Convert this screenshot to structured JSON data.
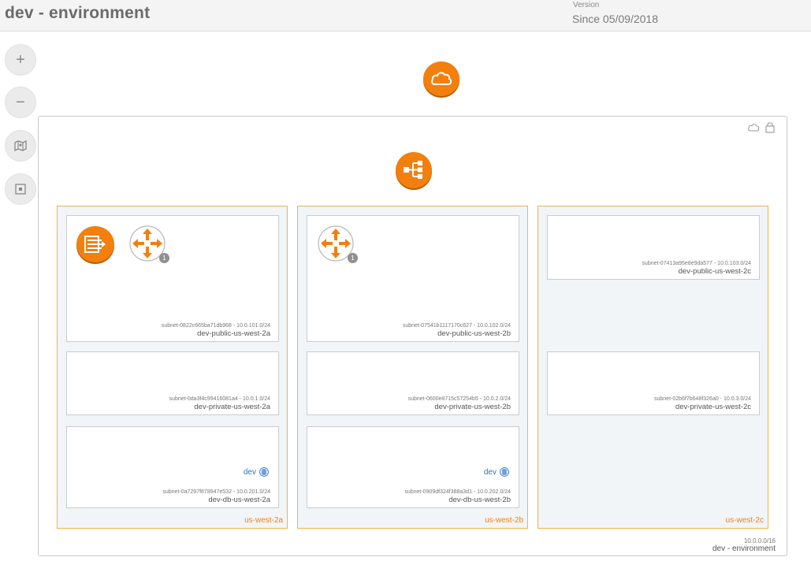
{
  "header": {
    "title": "dev - environment",
    "version_label": "Version",
    "version_value": "Since 05/09/2018"
  },
  "toolbar": {
    "zoom_in": "+",
    "zoom_out": "−"
  },
  "vpc": {
    "cidr": "10.0.0.0/16",
    "name": "dev - environment"
  },
  "zones": [
    {
      "label": "us-west-2a",
      "subnets": [
        {
          "id": "subnet-0822c665ba71db968 - 10.0.101.0/24",
          "name": "dev-public-us-west-2a"
        },
        {
          "id": "subnet-0da3f4c99416081a4 - 10.0.1.0/24",
          "name": "dev-private-us-west-2a"
        },
        {
          "id": "subnet-0a7297f878947e532 - 10.0.201.0/24",
          "name": "dev-db-us-west-2a",
          "db_label": "dev"
        }
      ],
      "router_badge": "1"
    },
    {
      "label": "us-west-2b",
      "subnets": [
        {
          "id": "subnet-07541b1117170c627 - 10.0.102.0/24",
          "name": "dev-public-us-west-2b"
        },
        {
          "id": "subnet-0600e8715c57254b5 - 10.0.2.0/24",
          "name": "dev-private-us-west-2b"
        },
        {
          "id": "subnet-0909df324f388a3d1 - 10.0.202.0/24",
          "name": "dev-db-us-west-2b",
          "db_label": "dev"
        }
      ],
      "router_badge": "1"
    },
    {
      "label": "us-west-2c",
      "subnets": [
        {
          "id": "subnet-07413a95e8e9da577 - 10.0.103.0/24",
          "name": "dev-public-us-west-2c"
        },
        {
          "id": "subnet-02b6f7b648f326a0 - 10.0.3.0/24",
          "name": "dev-private-us-west-2c"
        }
      ]
    }
  ],
  "colors": {
    "accent": "#f37f0f",
    "zone_border": "#f2b24a",
    "db_blue": "#2e74c0"
  },
  "icons": {
    "internet": "cloud-icon",
    "load_balancer": "load-balancer-icon",
    "nat_gateway": "nat-gateway-icon",
    "router": "router-icon",
    "database": "database-icon"
  }
}
